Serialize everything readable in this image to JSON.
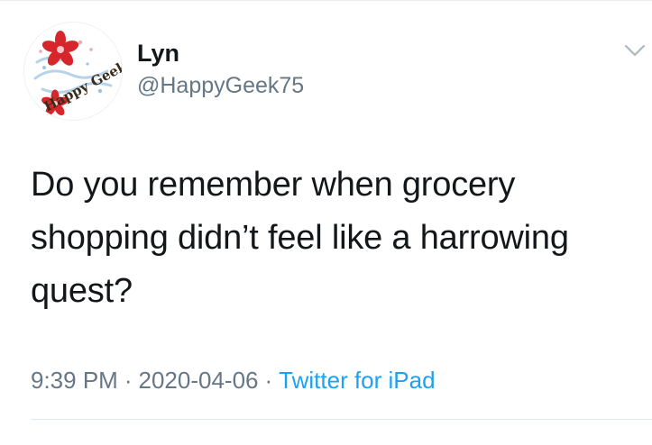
{
  "tweet": {
    "author": {
      "display_name": "Lyn",
      "handle": "@HappyGeek75",
      "avatar_text": "Happy Geek"
    },
    "text": "Do you remember when grocery shopping didn’t feel like a harrowing quest?",
    "meta": {
      "time": "9:39 PM",
      "separator": "·",
      "date": "2020-04-06",
      "source": "Twitter for iPad"
    }
  },
  "colors": {
    "text": "#14171a",
    "secondary": "#657786",
    "link": "#1da1f2",
    "divider": "#e1e8ed",
    "avatar_flower": "#d7262b"
  },
  "icons": {
    "menu": "chevron-down-icon"
  }
}
